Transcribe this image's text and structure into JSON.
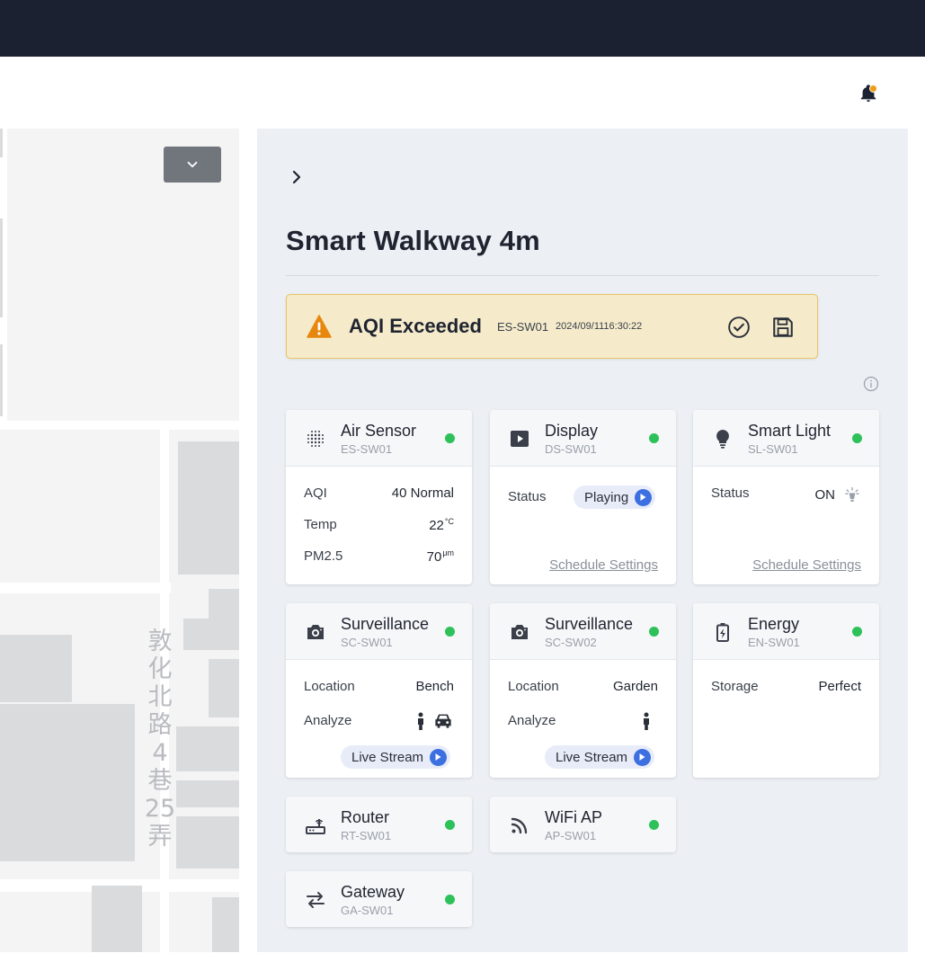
{
  "header": {
    "notification_icon": "bell-icon",
    "badge_color": "#f39c12"
  },
  "map": {
    "toggle_icon": "chevron-down-icon",
    "street_label": "敦化北路4巷25弄"
  },
  "panel": {
    "collapse_icon": "chevron-right-icon",
    "title": "Smart Walkway 4m",
    "alert": {
      "icon": "warning-icon",
      "title": "AQI Exceeded",
      "device": "ES-SW01",
      "timestamp": "2024/09/1116:30:22",
      "acknowledge_icon": "check-circle-icon",
      "save_icon": "save-icon"
    },
    "info_icon": "info-icon",
    "status_color": "#2ec15a",
    "devices": [
      {
        "name": "Air Sensor",
        "id": "ES-SW01",
        "icon": "sensor-grid-icon",
        "rows": [
          {
            "label": "AQI",
            "value": "40 Normal"
          },
          {
            "label": "Temp",
            "value": "22",
            "unit": "°C"
          },
          {
            "label": "PM2.5",
            "value": "70",
            "unit": "μm"
          }
        ]
      },
      {
        "name": "Display",
        "id": "DS-SW01",
        "icon": "display-play-icon",
        "rows": [
          {
            "label": "Status",
            "value": "Playing"
          }
        ],
        "link": "Schedule Settings"
      },
      {
        "name": "Smart Light",
        "id": "SL-SW01",
        "icon": "bulb-icon",
        "rows": [
          {
            "label": "Status",
            "value": "ON"
          }
        ],
        "link": "Schedule Settings"
      },
      {
        "name": "Surveillance",
        "id": "SC-SW01",
        "icon": "camera-icon",
        "rows": [
          {
            "label": "Location",
            "value": "Bench"
          },
          {
            "label": "Analyze",
            "value": ""
          }
        ],
        "action": "Live Stream"
      },
      {
        "name": "Surveillance",
        "id": "SC-SW02",
        "icon": "camera-icon",
        "rows": [
          {
            "label": "Location",
            "value": "Garden"
          },
          {
            "label": "Analyze",
            "value": ""
          }
        ],
        "action": "Live Stream"
      },
      {
        "name": "Energy",
        "id": "EN-SW01",
        "icon": "battery-charging-icon",
        "rows": [
          {
            "label": "Storage",
            "value": "Perfect"
          }
        ]
      },
      {
        "name": "Router",
        "id": "RT-SW01",
        "icon": "router-icon"
      },
      {
        "name": "WiFi AP",
        "id": "AP-SW01",
        "icon": "wifi-icon"
      },
      {
        "name": "Gateway",
        "id": "GA-SW01",
        "icon": "arrows-swap-icon"
      }
    ]
  }
}
